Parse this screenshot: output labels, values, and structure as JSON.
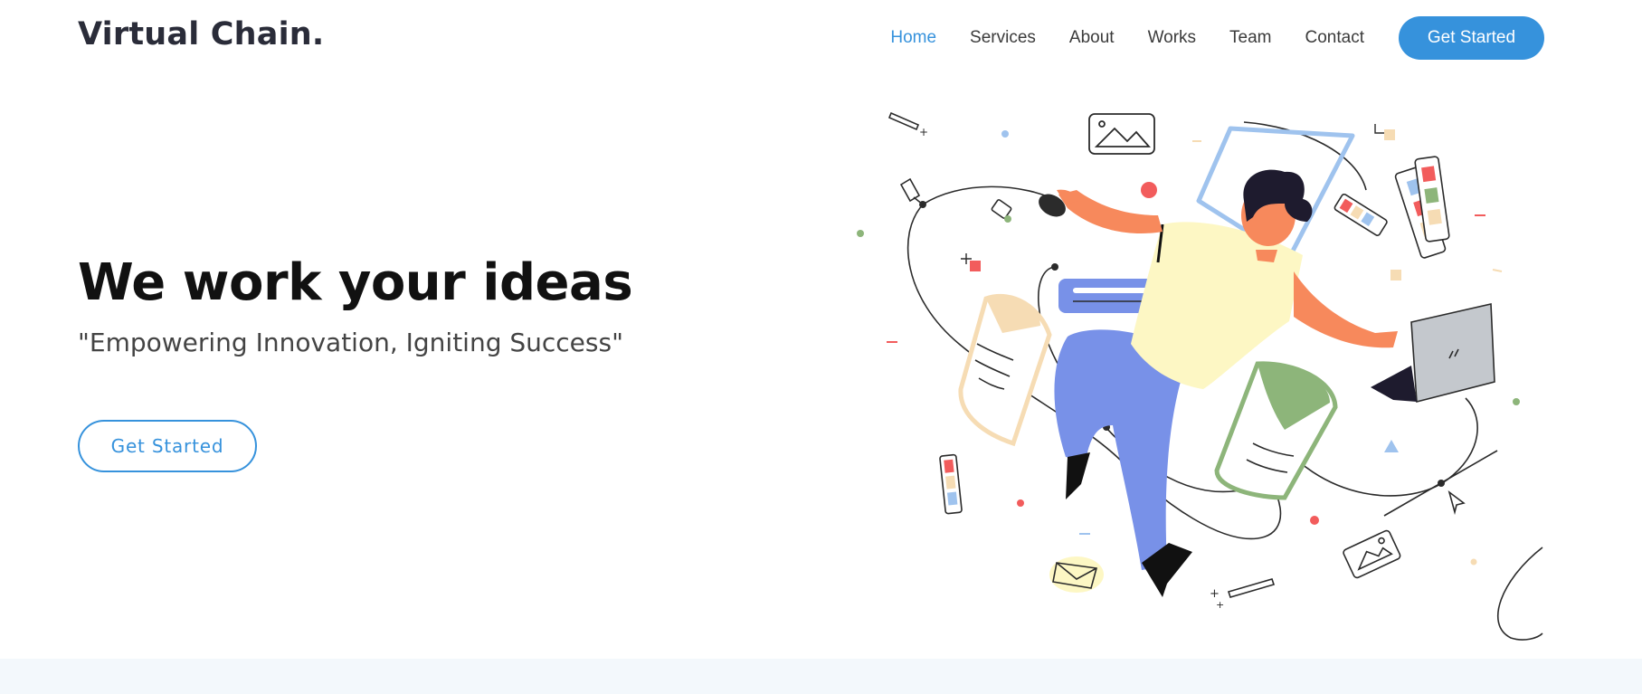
{
  "brand": {
    "name": "Virtual Chain",
    "dot": "."
  },
  "nav": {
    "items": [
      {
        "label": "Home",
        "active": true
      },
      {
        "label": "Services",
        "active": false
      },
      {
        "label": "About",
        "active": false
      },
      {
        "label": "Works",
        "active": false
      },
      {
        "label": "Team",
        "active": false
      },
      {
        "label": "Contact",
        "active": false
      }
    ],
    "cta_label": "Get Started"
  },
  "hero": {
    "title": "We work your ideas",
    "subtitle": "\"Empowering Innovation, Igniting Success\"",
    "cta_label": "Get Started"
  },
  "colors": {
    "accent": "#3692dc",
    "text_dark": "#111111",
    "band": "#f3f8fc",
    "skin": "#f7895c",
    "shirt": "#fdf7c4",
    "pants": "#7891e8",
    "green": "#8db57a",
    "peach": "#f6dcb4",
    "red": "#f25c5c"
  }
}
